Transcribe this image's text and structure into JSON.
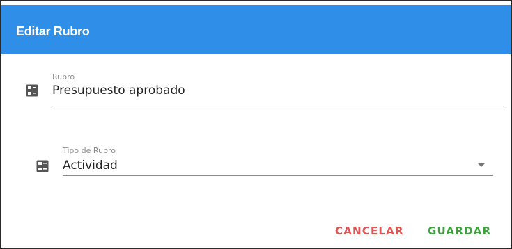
{
  "dialog": {
    "title": "Editar Rubro",
    "header_color": "#2f8fe8"
  },
  "fields": {
    "rubro": {
      "label": "Rubro",
      "value": "Presupuesto aprobado",
      "icon": "list-details-icon"
    },
    "tipo_rubro": {
      "label": "Tipo de Rubro",
      "selected_value": "Actividad",
      "icon": "list-details-icon"
    }
  },
  "actions": {
    "cancel_label": "CANCELAR",
    "cancel_color": "#e05454",
    "save_label": "GUARDAR",
    "save_color": "#3da23d"
  }
}
